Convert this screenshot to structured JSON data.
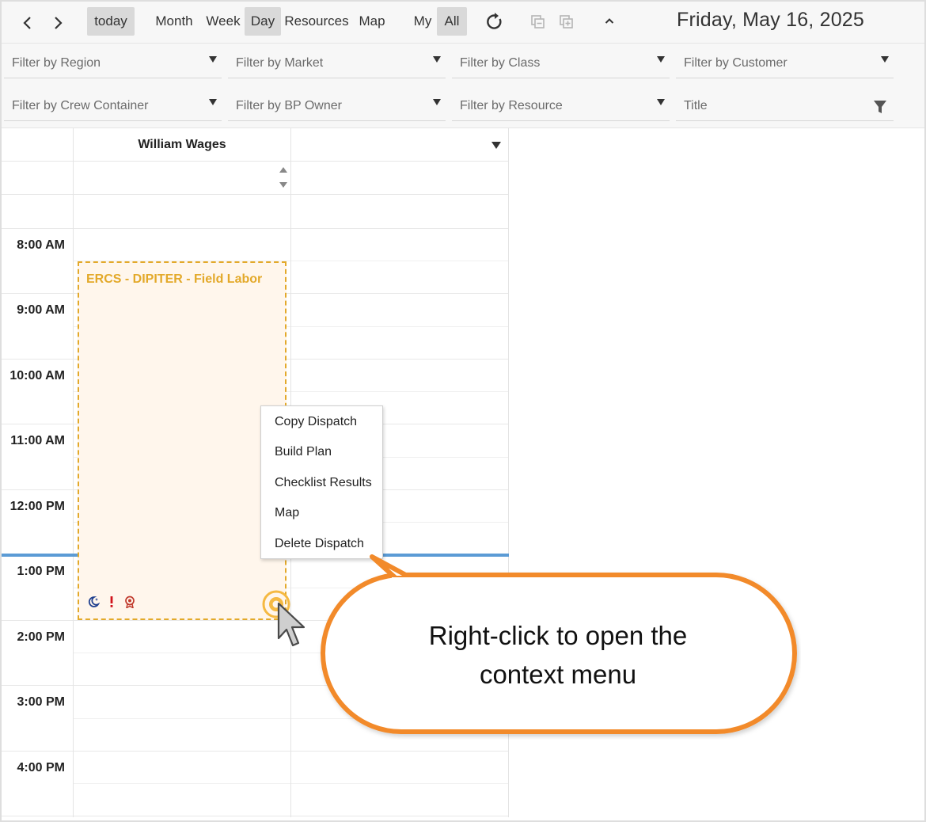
{
  "toolbar": {
    "today": "today",
    "views": [
      "Month",
      "Week",
      "Day",
      "Resources",
      "Map"
    ],
    "active_view": "Day",
    "scope": [
      "My",
      "All"
    ],
    "active_scope": "All",
    "date_title": "Friday, May 16, 2025"
  },
  "filters": {
    "region": "Filter by Region",
    "market": "Filter by Market",
    "class": "Filter by Class",
    "customer": "Filter by Customer",
    "crew_container": "Filter by Crew Container",
    "bp_owner": "Filter by BP Owner",
    "resource": "Filter by Resource",
    "title": "Title"
  },
  "scheduler": {
    "resource_name": "William Wages",
    "time_slots": [
      "8:00 AM",
      "9:00 AM",
      "10:00 AM",
      "11:00 AM",
      "12:00 PM",
      "1:00 PM",
      "2:00 PM",
      "3:00 PM",
      "4:00 PM"
    ],
    "event": {
      "title": "ERCS - DIPITER - Field Labor",
      "icons": [
        "moon-star-icon",
        "exclamation-icon",
        "award-icon"
      ]
    }
  },
  "context_menu": {
    "items": [
      "Copy Dispatch",
      "Build Plan",
      "Checklist Results",
      "Map",
      "Delete Dispatch"
    ]
  },
  "callout": {
    "line1": "Right-click to open the",
    "line2": "context menu"
  },
  "colors": {
    "event_border": "#e3a92a",
    "event_bg": "#fff6ec",
    "now_line": "#5b9bd5",
    "callout_border": "#f28a2a"
  }
}
